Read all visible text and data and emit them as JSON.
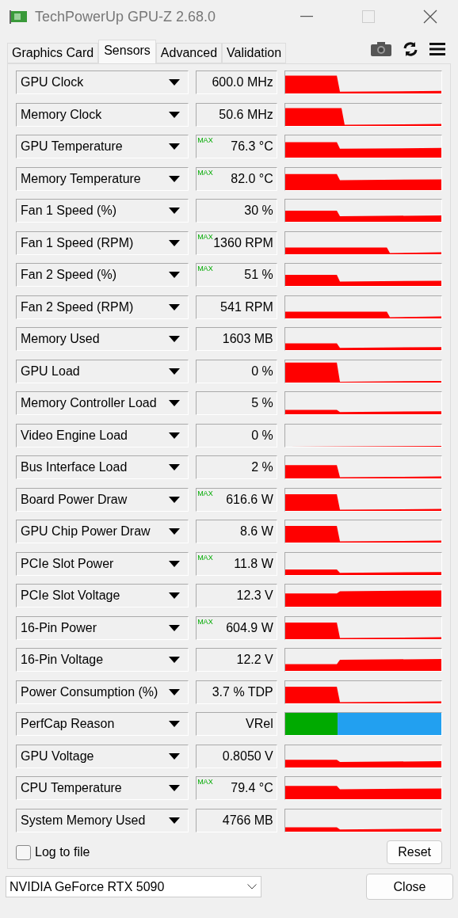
{
  "window": {
    "title": "TechPowerUp GPU-Z 2.68.0"
  },
  "tabs": [
    {
      "label": "Graphics Card",
      "selected": false
    },
    {
      "label": "Sensors",
      "selected": true
    },
    {
      "label": "Advanced",
      "selected": false
    },
    {
      "label": "Validation",
      "selected": false
    }
  ],
  "sensors": [
    {
      "name": "GPU Clock",
      "value": "600.0 MHz",
      "kind": "graph"
    },
    {
      "name": "Memory Clock",
      "value": "50.6 MHz",
      "kind": "graph"
    },
    {
      "name": "GPU Temperature",
      "max_tag": "MAX",
      "value": "76.3 °C",
      "kind": "graph"
    },
    {
      "name": "Memory Temperature",
      "max_tag": "MAX",
      "value": "82.0 °C",
      "kind": "graph"
    },
    {
      "name": "Fan 1 Speed (%)",
      "value": "30 %",
      "kind": "graph"
    },
    {
      "name": "Fan 1 Speed (RPM)",
      "max_tag": "MAX",
      "value": "1360 RPM",
      "kind": "graph"
    },
    {
      "name": "Fan 2 Speed (%)",
      "max_tag": "MAX",
      "value": "51 %",
      "kind": "graph"
    },
    {
      "name": "Fan 2 Speed (RPM)",
      "value": "541 RPM",
      "kind": "graph"
    },
    {
      "name": "Memory Used",
      "value": "1603 MB",
      "kind": "graph"
    },
    {
      "name": "GPU Load",
      "value": "0 %",
      "kind": "graph"
    },
    {
      "name": "Memory Controller Load",
      "value": "5 %",
      "kind": "graph"
    },
    {
      "name": "Video Engine Load",
      "value": "0 %",
      "kind": "graph"
    },
    {
      "name": "Bus Interface Load",
      "value": "2 %",
      "kind": "graph"
    },
    {
      "name": "Board Power Draw",
      "max_tag": "MAX",
      "value": "616.6 W",
      "kind": "graph"
    },
    {
      "name": "GPU Chip Power Draw",
      "value": "8.6 W",
      "kind": "graph"
    },
    {
      "name": "PCIe Slot Power",
      "max_tag": "MAX",
      "value": "11.8 W",
      "kind": "graph"
    },
    {
      "name": "PCIe Slot Voltage",
      "value": "12.3 V",
      "kind": "graph"
    },
    {
      "name": "16-Pin Power",
      "max_tag": "MAX",
      "value": "604.9 W",
      "kind": "graph"
    },
    {
      "name": "16-Pin Voltage",
      "value": "12.2 V",
      "kind": "graph"
    },
    {
      "name": "Power Consumption (%)",
      "value": "3.7 % TDP",
      "kind": "graph"
    },
    {
      "name": "PerfCap Reason",
      "value": "VRel",
      "kind": "perfcap"
    },
    {
      "name": "GPU Voltage",
      "value": "0.8050 V",
      "kind": "graph"
    },
    {
      "name": "CPU Temperature",
      "max_tag": "MAX",
      "value": "79.4 °C",
      "kind": "graph"
    },
    {
      "name": "System Memory Used",
      "value": "4766 MB",
      "kind": "graph"
    }
  ],
  "log_to_file": {
    "label": "Log to file",
    "checked": false
  },
  "reset_button": "Reset",
  "device_select": {
    "value": "NVIDIA GeForce RTX 5090"
  },
  "close_button": "Close"
}
